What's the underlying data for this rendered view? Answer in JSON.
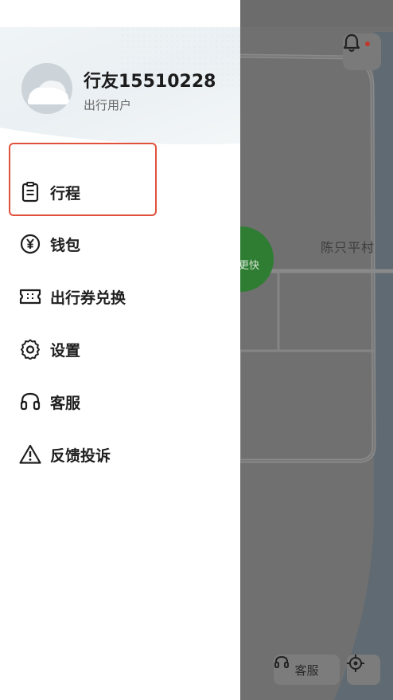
{
  "map": {
    "village_label": "陈只平村",
    "marker_label": "更快",
    "service_button_label": "客服",
    "icons": {
      "bell": "bell-icon",
      "headset": "headset-icon",
      "locate": "locate-icon"
    }
  },
  "profile": {
    "name": "行友15510228",
    "role": "出行用户",
    "avatar_icon": "car-avatar-icon"
  },
  "menu": {
    "items": [
      {
        "label": "行程",
        "icon": "clipboard-icon"
      },
      {
        "label": "钱包",
        "icon": "yen-coin-icon"
      },
      {
        "label": "出行券兑换",
        "icon": "ticket-icon"
      },
      {
        "label": "设置",
        "icon": "gear-icon"
      },
      {
        "label": "客服",
        "icon": "headset-icon"
      },
      {
        "label": "反馈投诉",
        "icon": "warning-icon"
      }
    ],
    "highlighted_index": 0
  },
  "colors": {
    "highlight_border": "#e0513b",
    "marker_green": "#2e7d32",
    "notification_dot": "#c0392b"
  }
}
